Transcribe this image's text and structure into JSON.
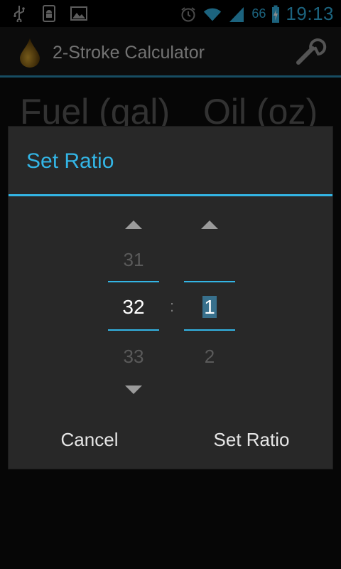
{
  "statusbar": {
    "left_icons": [
      "usb-icon",
      "android-debug-icon",
      "image-icon"
    ],
    "right_icons": [
      "alarm-icon",
      "wifi-icon",
      "signal-icon",
      "battery-charging-icon"
    ],
    "battery_level": "66",
    "time": "19:13",
    "accent": "#33b5e5"
  },
  "actionbar": {
    "title": "2-Stroke Calculator",
    "app_icon": "oil-drop-icon",
    "settings_icon": "wrench-icon"
  },
  "background": {
    "fuel_header": "Fuel (gal)",
    "oil_header": "Oil (oz)"
  },
  "dialog": {
    "title": "Set Ratio",
    "separator": ":",
    "left_picker": {
      "above": "31",
      "selected": "32",
      "below": "33"
    },
    "right_picker": {
      "above": "",
      "selected": "1",
      "below": "2"
    },
    "cancel_label": "Cancel",
    "confirm_label": "Set Ratio"
  }
}
